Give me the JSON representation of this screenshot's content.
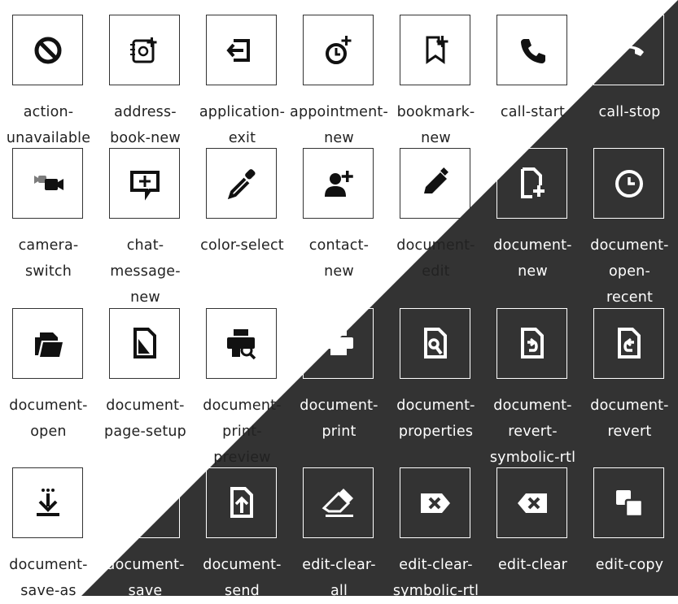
{
  "colors": {
    "light_bg": "#ffffff",
    "dark_bg": "#333333",
    "light_fg": "#111111",
    "dark_fg": "#ffffff"
  },
  "icons": [
    {
      "label": "action-\nunavailable",
      "icon": "action-unavailable-icon",
      "theme": "light"
    },
    {
      "label": "address-\nbook-new",
      "icon": "address-book-new-icon",
      "theme": "light"
    },
    {
      "label": "application-\nexit",
      "icon": "application-exit-icon",
      "theme": "light"
    },
    {
      "label": "appointment-\nnew",
      "icon": "appointment-new-icon",
      "theme": "light"
    },
    {
      "label": "bookmark-\nnew",
      "icon": "bookmark-new-icon",
      "theme": "light"
    },
    {
      "label": "call-start",
      "icon": "call-start-icon",
      "theme": "light"
    },
    {
      "label": "call-stop",
      "icon": "call-stop-icon",
      "theme": "dark"
    },
    {
      "label": "camera-\nswitch",
      "icon": "camera-switch-icon",
      "theme": "light"
    },
    {
      "label": "chat-\nmessage-\nnew",
      "icon": "chat-message-new-icon",
      "theme": "light"
    },
    {
      "label": "color-select",
      "icon": "color-select-icon",
      "theme": "light"
    },
    {
      "label": "contact-\nnew",
      "icon": "contact-new-icon",
      "theme": "light"
    },
    {
      "label": "document-\nedit",
      "icon": "document-edit-icon",
      "theme": "light"
    },
    {
      "label": "document-\nnew",
      "icon": "document-new-icon",
      "theme": "dark"
    },
    {
      "label": "document-\nopen-\nrecent",
      "icon": "document-open-recent-icon",
      "theme": "dark"
    },
    {
      "label": "document-\nopen",
      "icon": "document-open-icon",
      "theme": "light"
    },
    {
      "label": "document-\npage-setup",
      "icon": "document-page-setup-icon",
      "theme": "light"
    },
    {
      "label": "document-\nprint-\npreview",
      "icon": "document-print-preview-icon",
      "theme": "light"
    },
    {
      "label": "document-\nprint",
      "icon": "document-print-icon",
      "theme": "dark"
    },
    {
      "label": "document-\nproperties",
      "icon": "document-properties-icon",
      "theme": "dark"
    },
    {
      "label": "document-\nrevert-\nsymbolic-rtl",
      "icon": "document-revert-rtl-icon",
      "theme": "dark"
    },
    {
      "label": "document-\nrevert",
      "icon": "document-revert-icon",
      "theme": "dark"
    },
    {
      "label": "document-\nsave-as",
      "icon": "document-save-as-icon",
      "theme": "light"
    },
    {
      "label": "document-\nsave",
      "icon": "document-save-icon",
      "theme": "dark"
    },
    {
      "label": "document-\nsend",
      "icon": "document-send-icon",
      "theme": "dark"
    },
    {
      "label": "edit-clear-\nall",
      "icon": "edit-clear-all-icon",
      "theme": "dark"
    },
    {
      "label": "edit-clear-\nsymbolic-rtl",
      "icon": "edit-clear-rtl-icon",
      "theme": "dark"
    },
    {
      "label": "edit-clear",
      "icon": "edit-clear-icon",
      "theme": "dark"
    },
    {
      "label": "edit-copy",
      "icon": "edit-copy-icon",
      "theme": "dark"
    }
  ]
}
